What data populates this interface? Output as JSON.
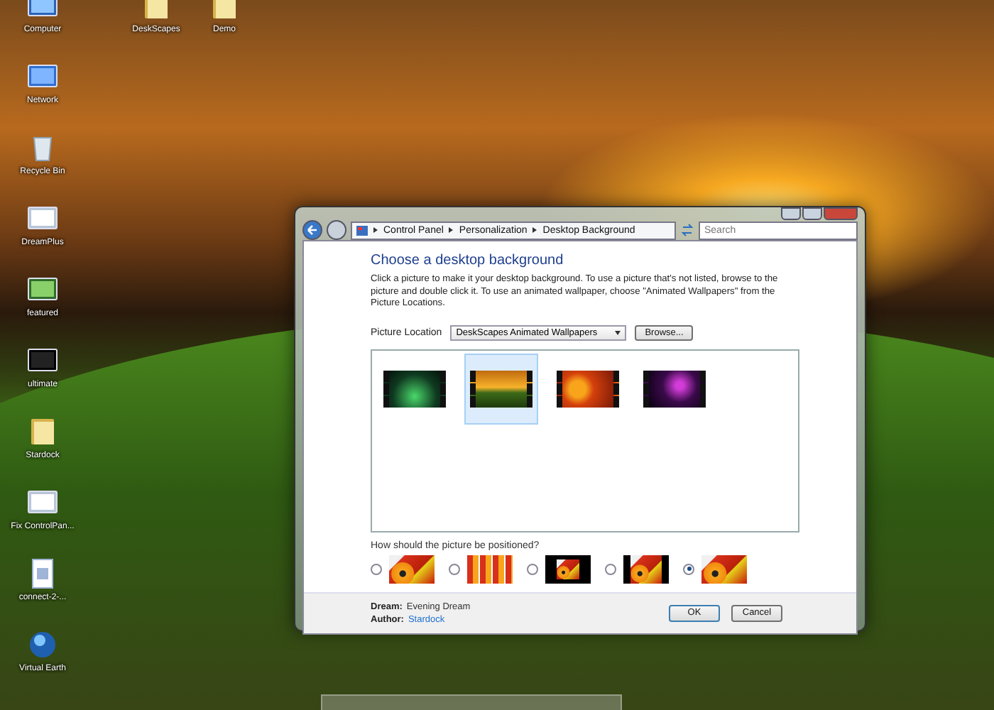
{
  "desktop_icons_top": [
    {
      "label": "DeskScapes",
      "kind": "folder"
    },
    {
      "label": "Demo",
      "kind": "folder"
    }
  ],
  "desktop_icons": [
    {
      "label": "Computer",
      "kind": "computer"
    },
    {
      "label": "Network",
      "kind": "network"
    },
    {
      "label": "Recycle Bin",
      "kind": "bin"
    },
    {
      "label": "DreamPlus",
      "kind": "app"
    },
    {
      "label": "featured",
      "kind": "image"
    },
    {
      "label": "ultimate",
      "kind": "screen"
    },
    {
      "label": "Stardock",
      "kind": "folder"
    },
    {
      "label": "Fix ControlPan...",
      "kind": "app"
    },
    {
      "label": "connect-2-...",
      "kind": "doc"
    },
    {
      "label": "Virtual Earth",
      "kind": "globe"
    }
  ],
  "window": {
    "breadcrumbs": [
      "Control Panel",
      "Personalization",
      "Desktop Background"
    ],
    "search": {
      "placeholder": "Search"
    },
    "heading": "Choose a desktop background",
    "description": "Click a picture to make it your desktop background. To use a picture that's not listed, browse to the picture and double click it. To use an animated wallpaper, choose \"Animated Wallpapers\" from the Picture Locations.",
    "location": {
      "label": "Picture Location",
      "value": "DeskScapes Animated Wallpapers",
      "browse": "Browse..."
    },
    "wallpapers": [
      {
        "kind": "aurora",
        "selected": false
      },
      {
        "kind": "sunset",
        "selected": true
      },
      {
        "kind": "flowers",
        "selected": false
      },
      {
        "kind": "swirl",
        "selected": false
      }
    ],
    "position": {
      "question": "How should the picture be positioned?",
      "options": [
        {
          "kind": "fill",
          "selected": false
        },
        {
          "kind": "tile",
          "selected": false
        },
        {
          "kind": "center",
          "selected": false
        },
        {
          "kind": "fit",
          "selected": false
        },
        {
          "kind": "stretch",
          "selected": true
        }
      ]
    },
    "footer": {
      "dream_label": "Dream:",
      "dream": "Evening Dream",
      "author_label": "Author:",
      "author": "Stardock",
      "ok": "OK",
      "cancel": "Cancel"
    }
  }
}
